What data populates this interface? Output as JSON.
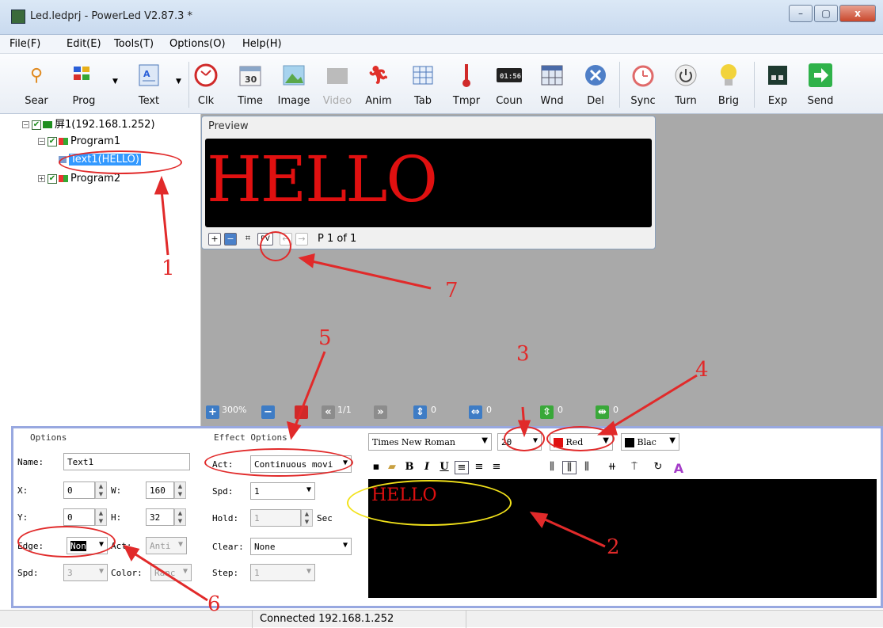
{
  "window": {
    "title": "Led.ledprj - PowerLed V2.87.3 *",
    "minimize": "–",
    "maximize": "▢",
    "close": "x"
  },
  "menu": [
    "File(F)",
    "Edit(E)",
    "Tools(T)",
    "Options(O)",
    "Help(H)"
  ],
  "toolbar": {
    "sear": "Sear",
    "prog": "Prog",
    "text": "Text",
    "clk": "Clk",
    "time": "Time",
    "image": "Image",
    "video": "Video",
    "anim": "Anim",
    "tab": "Tab",
    "tmpr": "Tmpr",
    "coun": "Coun",
    "wnd": "Wnd",
    "del": "Del",
    "sync": "Sync",
    "turn": "Turn",
    "brig": "Brig",
    "exp": "Exp",
    "send": "Send",
    "time_num": "30",
    "coun_num": "01:56"
  },
  "tree": {
    "screen": "屏1(192.168.1.252)",
    "program1": "Program1",
    "text1": "Text1(HELLO)",
    "program2": "Program2"
  },
  "preview": {
    "title": "Preview",
    "content": "HELLO",
    "pv": "PV",
    "page": "P 1 of 1"
  },
  "bottom_bar": {
    "zoom": "300%",
    "page": "1/1",
    "v1": "0",
    "v2": "0",
    "v3": "0",
    "v4": "0"
  },
  "options": {
    "title": "Options",
    "name_label": "Name:",
    "name_value": "Text1",
    "x_label": "X:",
    "x_value": "0",
    "w_label": "W:",
    "w_value": "160",
    "y_label": "Y:",
    "y_value": "0",
    "h_label": "H:",
    "h_value": "32",
    "edge_label": "Edge:",
    "edge_value": "Non",
    "act_label": "Act:",
    "act_value": "Anti",
    "spd_label": "Spd:",
    "spd_value": "3",
    "color_label": "Color:",
    "color_value": "Ranc"
  },
  "effect": {
    "title": "Effect Options",
    "act_label": "Act:",
    "act_value": "Continuous movi",
    "spd_label": "Spd:",
    "spd_value": "1",
    "hold_label": "Hold:",
    "hold_value": "1",
    "hold_unit": "Sec",
    "clear_label": "Clear:",
    "clear_value": "None",
    "step_label": "Step:",
    "step_value": "1"
  },
  "format": {
    "font": "Times New Roman",
    "size": "20",
    "fore_color": "Red",
    "back_color": "Blac",
    "bold": "B",
    "italic": "I",
    "underline": "U"
  },
  "editor": {
    "content": "HELLO"
  },
  "status": {
    "text": "Connected 192.168.1.252"
  },
  "annotations": [
    "1",
    "2",
    "3",
    "4",
    "5",
    "6",
    "7"
  ],
  "colors": {
    "accent_red": "#e12a2a",
    "led_red": "#e01010",
    "annotation_yellow": "#f2e21a"
  }
}
